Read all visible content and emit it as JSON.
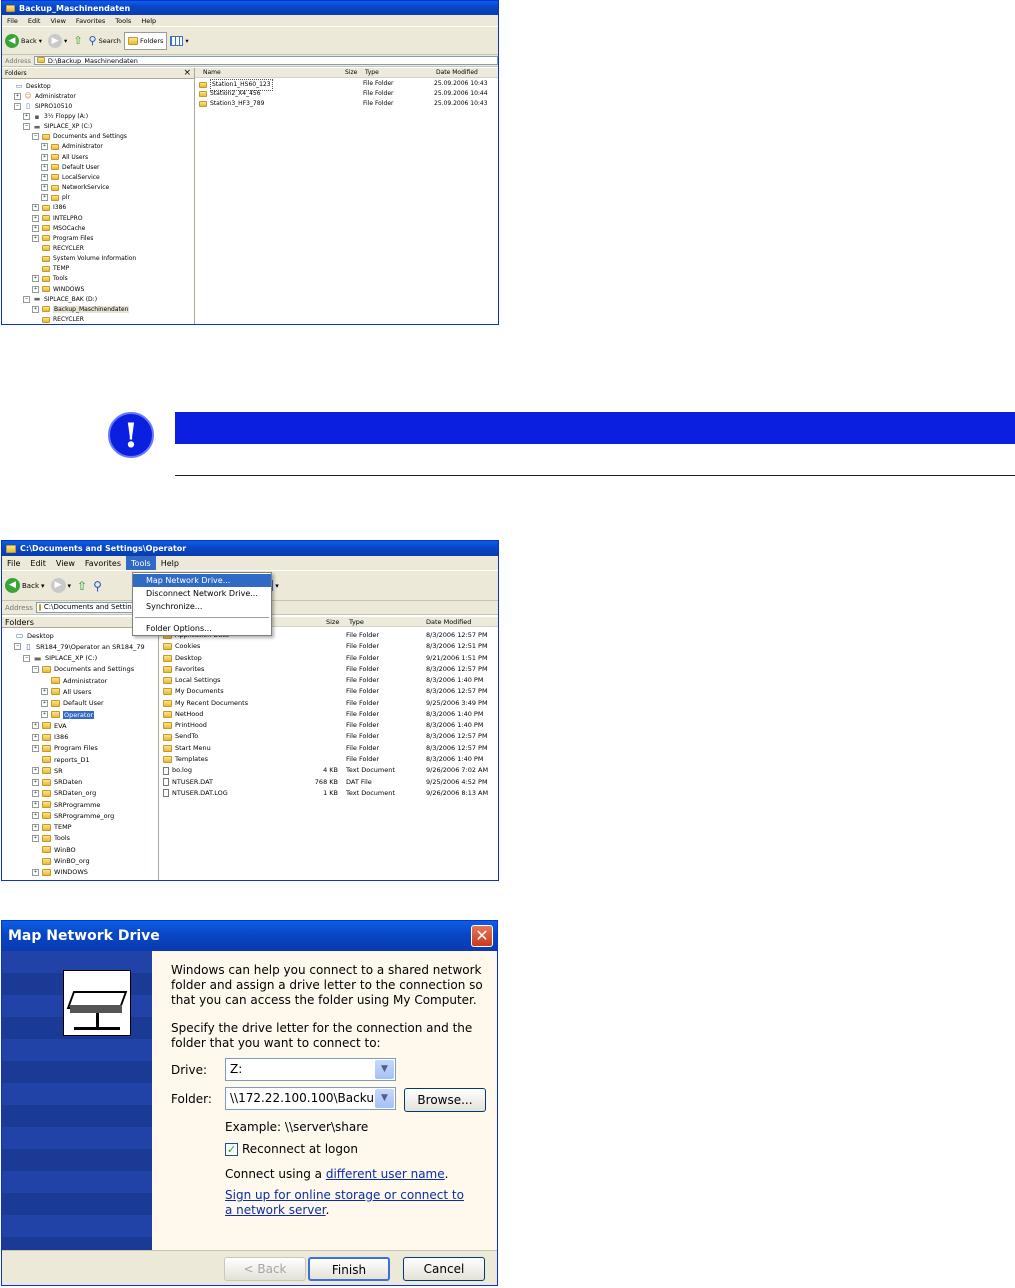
{
  "explorer1": {
    "title": "Backup_Maschinendaten",
    "menu": [
      "File",
      "Edit",
      "View",
      "Favorites",
      "Tools",
      "Help"
    ],
    "toolbar": {
      "back": "Back",
      "search": "Search",
      "folders": "Folders"
    },
    "address_label": "Address",
    "address_value": "D:\\Backup_Maschinendaten",
    "folders_label": "Folders",
    "close_glyph": "×",
    "tree": [
      {
        "label": "Desktop",
        "pm": "",
        "kind": "desktop"
      },
      {
        "label": "Administrator",
        "pm": "+",
        "kind": "user"
      },
      {
        "label": "SIPRO10510",
        "pm": "−",
        "kind": "pc"
      },
      {
        "label": "3½ Floppy (A:)",
        "pm": "+",
        "kind": "floppy"
      },
      {
        "label": "SIPLACE_XP (C:)",
        "pm": "−",
        "kind": "drive"
      },
      {
        "label": "Documents and Settings",
        "pm": "−",
        "kind": "folder"
      },
      {
        "label": "Administrator",
        "pm": "+",
        "kind": "folder"
      },
      {
        "label": "All Users",
        "pm": "+",
        "kind": "folder"
      },
      {
        "label": "Default User",
        "pm": "+",
        "kind": "folder"
      },
      {
        "label": "LocalService",
        "pm": "+",
        "kind": "folder"
      },
      {
        "label": "NetworkService",
        "pm": "+",
        "kind": "folder"
      },
      {
        "label": "plr",
        "pm": "+",
        "kind": "folder"
      },
      {
        "label": "I386",
        "pm": "+",
        "kind": "folder"
      },
      {
        "label": "INTELPRO",
        "pm": "+",
        "kind": "folder"
      },
      {
        "label": "MSOCache",
        "pm": "+",
        "kind": "folder"
      },
      {
        "label": "Program Files",
        "pm": "+",
        "kind": "folder"
      },
      {
        "label": "RECYCLER",
        "pm": "",
        "kind": "folder"
      },
      {
        "label": "System Volume Information",
        "pm": "",
        "kind": "folder"
      },
      {
        "label": "TEMP",
        "pm": "",
        "kind": "folder"
      },
      {
        "label": "Tools",
        "pm": "+",
        "kind": "folder"
      },
      {
        "label": "WINDOWS",
        "pm": "+",
        "kind": "folder"
      },
      {
        "label": "SIPLACE_BAK (D:)",
        "pm": "−",
        "kind": "drive"
      },
      {
        "label": "Backup_Maschinendaten",
        "pm": "+",
        "kind": "folder"
      },
      {
        "label": "RECYCLER",
        "pm": "",
        "kind": "folder"
      }
    ],
    "columns": [
      "Name",
      "Size",
      "Type",
      "Date Modified"
    ],
    "rows": [
      {
        "name": "Station1_HS60_123",
        "size": "",
        "type": "File Folder",
        "date": "25.09.2006 10:43"
      },
      {
        "name": "Station2_X4_456",
        "size": "",
        "type": "File Folder",
        "date": "25.09.2006 10:44"
      },
      {
        "name": "Station3_HF3_789",
        "size": "",
        "type": "File Folder",
        "date": "25.09.2006 10:43"
      }
    ]
  },
  "explorer2": {
    "title": "C:\\Documents and Settings\\Operator",
    "menu": [
      "File",
      "Edit",
      "View",
      "Favorites",
      "Tools",
      "Help"
    ],
    "toolbar": {
      "back": "Back"
    },
    "address_label": "Address",
    "address_value": "C:\\Documents and Settings",
    "folders_label": "Folders",
    "tools_menu": [
      "Map Network Drive...",
      "Disconnect Network Drive...",
      "Synchronize...",
      "Folder Options..."
    ],
    "tree": [
      {
        "label": "Desktop",
        "pm": "",
        "kind": "desktop"
      },
      {
        "label": "SR184_79\\Operator an SR184_79",
        "pm": "−",
        "kind": "pc"
      },
      {
        "label": "SIPLACE_XP (C:)",
        "pm": "−",
        "kind": "drive"
      },
      {
        "label": "Documents and Settings",
        "pm": "−",
        "kind": "folder"
      },
      {
        "label": "Administrator",
        "pm": "",
        "kind": "folder"
      },
      {
        "label": "All Users",
        "pm": "+",
        "kind": "folder"
      },
      {
        "label": "Default User",
        "pm": "+",
        "kind": "folder"
      },
      {
        "label": "Operator",
        "pm": "+",
        "kind": "folder"
      },
      {
        "label": "EVA",
        "pm": "+",
        "kind": "folder"
      },
      {
        "label": "I386",
        "pm": "+",
        "kind": "folder"
      },
      {
        "label": "Program Files",
        "pm": "+",
        "kind": "folder"
      },
      {
        "label": "reports_D1",
        "pm": "",
        "kind": "folder"
      },
      {
        "label": "SR",
        "pm": "+",
        "kind": "folder"
      },
      {
        "label": "SRDaten",
        "pm": "+",
        "kind": "folder"
      },
      {
        "label": "SRDaten_org",
        "pm": "+",
        "kind": "folder"
      },
      {
        "label": "SRProgramme",
        "pm": "+",
        "kind": "folder"
      },
      {
        "label": "SRProgramme_org",
        "pm": "+",
        "kind": "folder"
      },
      {
        "label": "TEMP",
        "pm": "+",
        "kind": "folder"
      },
      {
        "label": "Tools",
        "pm": "+",
        "kind": "folder"
      },
      {
        "label": "WinBO",
        "pm": "",
        "kind": "folder"
      },
      {
        "label": "WinBO_org",
        "pm": "",
        "kind": "folder"
      },
      {
        "label": "WINDOWS",
        "pm": "+",
        "kind": "folder"
      }
    ],
    "columns": [
      "Size",
      "Type",
      "Date Modified"
    ],
    "rows": [
      {
        "name": "Application Data",
        "size": "",
        "type": "File Folder",
        "date": "8/3/2006 12:57 PM"
      },
      {
        "name": "Cookies",
        "size": "",
        "type": "File Folder",
        "date": "8/3/2006 12:51 PM"
      },
      {
        "name": "Desktop",
        "size": "",
        "type": "File Folder",
        "date": "9/21/2006 1:51 PM"
      },
      {
        "name": "Favorites",
        "size": "",
        "type": "File Folder",
        "date": "8/3/2006 12:57 PM"
      },
      {
        "name": "Local Settings",
        "size": "",
        "type": "File Folder",
        "date": "8/3/2006 1:40 PM"
      },
      {
        "name": "My Documents",
        "size": "",
        "type": "File Folder",
        "date": "8/3/2006 12:57 PM"
      },
      {
        "name": "My Recent Documents",
        "size": "",
        "type": "File Folder",
        "date": "9/25/2006 3:49 PM"
      },
      {
        "name": "NetHood",
        "size": "",
        "type": "File Folder",
        "date": "8/3/2006 1:40 PM"
      },
      {
        "name": "PrintHood",
        "size": "",
        "type": "File Folder",
        "date": "8/3/2006 1:40 PM"
      },
      {
        "name": "SendTo",
        "size": "",
        "type": "File Folder",
        "date": "8/3/2006 12:57 PM"
      },
      {
        "name": "Start Menu",
        "size": "",
        "type": "File Folder",
        "date": "8/3/2006 12:57 PM"
      },
      {
        "name": "Templates",
        "size": "",
        "type": "File Folder",
        "date": "8/3/2006 1:40 PM"
      },
      {
        "name": "bo.log",
        "size": "4 KB",
        "type": "Text Document",
        "date": "9/26/2006 7:02 AM"
      },
      {
        "name": "NTUSER.DAT",
        "size": "768 KB",
        "type": "DAT File",
        "date": "9/25/2006 4:52 PM"
      },
      {
        "name": "NTUSER.DAT.LOG",
        "size": "1 KB",
        "type": "Text Document",
        "date": "9/26/2006 8:13 AM"
      }
    ]
  },
  "dialog": {
    "title": "Map Network Drive",
    "intro": "Windows can help you connect to a shared network folder and assign a drive letter to the connection so that you can access the folder using My Computer.",
    "specify": "Specify the drive letter for the connection and the folder that you want to connect to:",
    "drive_label": "Drive:",
    "drive_value": "Z:",
    "folder_label": "Folder:",
    "folder_value": "\\\\172.22.100.100\\Backu",
    "browse": "Browse...",
    "example": "Example: \\\\server\\share",
    "reconnect": "Reconnect at logon",
    "reconnect_checked": true,
    "connect_prefix": "Connect using a ",
    "connect_link": "different user name",
    "connect_suffix": ".",
    "signup_link": "Sign up for online storage or connect to a network server",
    "signup_suffix": ".",
    "back": "< Back",
    "finish": "Finish",
    "cancel": "Cancel"
  },
  "colors": {
    "note_bar": "#0b1fe0",
    "xp_blue": "#0a52d6"
  }
}
